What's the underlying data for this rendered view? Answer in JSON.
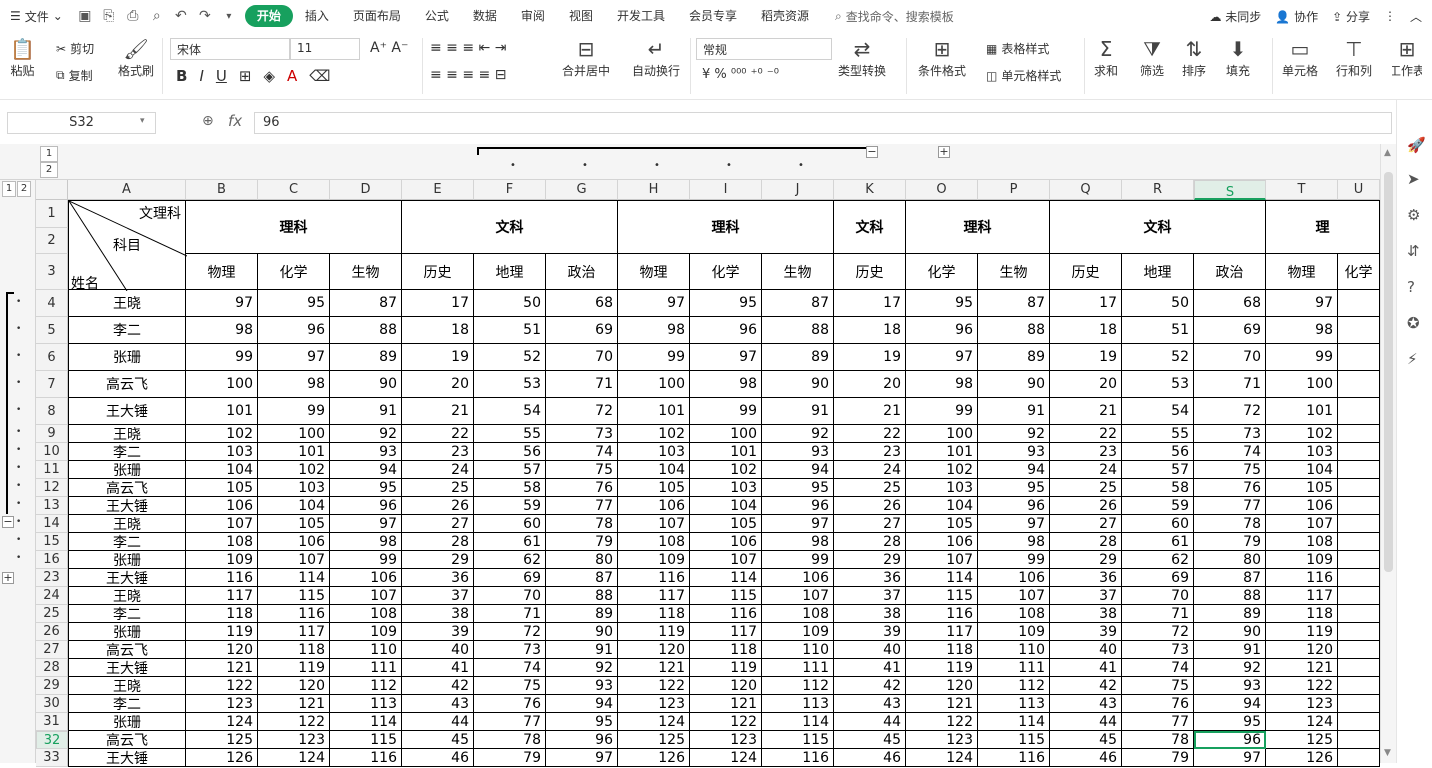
{
  "menu": {
    "file": "文件",
    "tabs": [
      "开始",
      "插入",
      "页面布局",
      "公式",
      "数据",
      "审阅",
      "视图",
      "开发工具",
      "会员专享",
      "稻壳资源"
    ],
    "search": "查找命令、搜索模板",
    "right": [
      "未同步",
      "协作",
      "分享"
    ]
  },
  "ribbon": {
    "paste": "粘贴",
    "cut": "剪切",
    "copy": "复制",
    "format_painter": "格式刷",
    "font": "宋体",
    "size": "11",
    "merge": "合并居中",
    "wrap": "自动换行",
    "numfmt": "常规",
    "convert": "类型转换",
    "cond": "条件格式",
    "table_style": "表格样式",
    "cell_style": "单元格样式",
    "sum": "求和",
    "filter": "筛选",
    "sort": "排序",
    "fill": "填充",
    "cell": "单元格",
    "rowcol": "行和列",
    "sheet": "工作表"
  },
  "formula": {
    "name": "S32",
    "value": "96"
  },
  "outline": {
    "top_levels": [
      "1",
      "2"
    ],
    "left_levels": [
      "1",
      "2"
    ],
    "minus": "−",
    "plus": "+"
  },
  "columns": [
    "A",
    "B",
    "C",
    "D",
    "E",
    "F",
    "G",
    "H",
    "I",
    "J",
    "K",
    "O",
    "P",
    "Q",
    "R",
    "S",
    "T",
    "U"
  ],
  "selected_col": "S",
  "header": {
    "diag_top": "文理科",
    "diag_mid": "科目",
    "diag_bot": "姓名",
    "groups": [
      "理科",
      "文科",
      "理科",
      "文科",
      "理科",
      "文科",
      "理"
    ],
    "subjects": [
      "物理",
      "化学",
      "生物",
      "历史",
      "地理",
      "政治",
      "物理",
      "化学",
      "生物",
      "历史",
      "化学",
      "生物",
      "历史",
      "地理",
      "政治",
      "物理",
      "化学"
    ]
  },
  "rows": [
    {
      "n": "4",
      "name": "王晓",
      "v": [
        "97",
        "95",
        "87",
        "17",
        "50",
        "68",
        "97",
        "95",
        "87",
        "17",
        "95",
        "87",
        "17",
        "50",
        "68",
        "97"
      ]
    },
    {
      "n": "5",
      "name": "李二",
      "v": [
        "98",
        "96",
        "88",
        "18",
        "51",
        "69",
        "98",
        "96",
        "88",
        "18",
        "96",
        "88",
        "18",
        "51",
        "69",
        "98"
      ]
    },
    {
      "n": "6",
      "name": "张珊",
      "v": [
        "99",
        "97",
        "89",
        "19",
        "52",
        "70",
        "99",
        "97",
        "89",
        "19",
        "97",
        "89",
        "19",
        "52",
        "70",
        "99"
      ]
    },
    {
      "n": "7",
      "name": "高云飞",
      "v": [
        "100",
        "98",
        "90",
        "20",
        "53",
        "71",
        "100",
        "98",
        "90",
        "20",
        "98",
        "90",
        "20",
        "53",
        "71",
        "100"
      ]
    },
    {
      "n": "8",
      "name": "王大锤",
      "v": [
        "101",
        "99",
        "91",
        "21",
        "54",
        "72",
        "101",
        "99",
        "91",
        "21",
        "99",
        "91",
        "21",
        "54",
        "72",
        "101"
      ]
    },
    {
      "n": "9",
      "name": "王晓",
      "v": [
        "102",
        "100",
        "92",
        "22",
        "55",
        "73",
        "102",
        "100",
        "92",
        "22",
        "100",
        "92",
        "22",
        "55",
        "73",
        "102"
      ]
    },
    {
      "n": "10",
      "name": "李二",
      "v": [
        "103",
        "101",
        "93",
        "23",
        "56",
        "74",
        "103",
        "101",
        "93",
        "23",
        "101",
        "93",
        "23",
        "56",
        "74",
        "103"
      ]
    },
    {
      "n": "11",
      "name": "张珊",
      "v": [
        "104",
        "102",
        "94",
        "24",
        "57",
        "75",
        "104",
        "102",
        "94",
        "24",
        "102",
        "94",
        "24",
        "57",
        "75",
        "104"
      ]
    },
    {
      "n": "12",
      "name": "高云飞",
      "v": [
        "105",
        "103",
        "95",
        "25",
        "58",
        "76",
        "105",
        "103",
        "95",
        "25",
        "103",
        "95",
        "25",
        "58",
        "76",
        "105"
      ]
    },
    {
      "n": "13",
      "name": "王大锤",
      "v": [
        "106",
        "104",
        "96",
        "26",
        "59",
        "77",
        "106",
        "104",
        "96",
        "26",
        "104",
        "96",
        "26",
        "59",
        "77",
        "106"
      ]
    },
    {
      "n": "14",
      "name": "王晓",
      "v": [
        "107",
        "105",
        "97",
        "27",
        "60",
        "78",
        "107",
        "105",
        "97",
        "27",
        "105",
        "97",
        "27",
        "60",
        "78",
        "107"
      ]
    },
    {
      "n": "15",
      "name": "李二",
      "v": [
        "108",
        "106",
        "98",
        "28",
        "61",
        "79",
        "108",
        "106",
        "98",
        "28",
        "106",
        "98",
        "28",
        "61",
        "79",
        "108"
      ]
    },
    {
      "n": "16",
      "name": "张珊",
      "v": [
        "109",
        "107",
        "99",
        "29",
        "62",
        "80",
        "109",
        "107",
        "99",
        "29",
        "107",
        "99",
        "29",
        "62",
        "80",
        "109"
      ]
    },
    {
      "n": "23",
      "name": "王大锤",
      "v": [
        "116",
        "114",
        "106",
        "36",
        "69",
        "87",
        "116",
        "114",
        "106",
        "36",
        "114",
        "106",
        "36",
        "69",
        "87",
        "116"
      ]
    },
    {
      "n": "24",
      "name": "王晓",
      "v": [
        "117",
        "115",
        "107",
        "37",
        "70",
        "88",
        "117",
        "115",
        "107",
        "37",
        "115",
        "107",
        "37",
        "70",
        "88",
        "117"
      ]
    },
    {
      "n": "25",
      "name": "李二",
      "v": [
        "118",
        "116",
        "108",
        "38",
        "71",
        "89",
        "118",
        "116",
        "108",
        "38",
        "116",
        "108",
        "38",
        "71",
        "89",
        "118"
      ]
    },
    {
      "n": "26",
      "name": "张珊",
      "v": [
        "119",
        "117",
        "109",
        "39",
        "72",
        "90",
        "119",
        "117",
        "109",
        "39",
        "117",
        "109",
        "39",
        "72",
        "90",
        "119"
      ]
    },
    {
      "n": "27",
      "name": "高云飞",
      "v": [
        "120",
        "118",
        "110",
        "40",
        "73",
        "91",
        "120",
        "118",
        "110",
        "40",
        "118",
        "110",
        "40",
        "73",
        "91",
        "120"
      ]
    },
    {
      "n": "28",
      "name": "王大锤",
      "v": [
        "121",
        "119",
        "111",
        "41",
        "74",
        "92",
        "121",
        "119",
        "111",
        "41",
        "119",
        "111",
        "41",
        "74",
        "92",
        "121"
      ]
    },
    {
      "n": "29",
      "name": "王晓",
      "v": [
        "122",
        "120",
        "112",
        "42",
        "75",
        "93",
        "122",
        "120",
        "112",
        "42",
        "120",
        "112",
        "42",
        "75",
        "93",
        "122"
      ]
    },
    {
      "n": "30",
      "name": "李二",
      "v": [
        "123",
        "121",
        "113",
        "43",
        "76",
        "94",
        "123",
        "121",
        "113",
        "43",
        "121",
        "113",
        "43",
        "76",
        "94",
        "123"
      ]
    },
    {
      "n": "31",
      "name": "张珊",
      "v": [
        "124",
        "122",
        "114",
        "44",
        "77",
        "95",
        "124",
        "122",
        "114",
        "44",
        "122",
        "114",
        "44",
        "77",
        "95",
        "124"
      ]
    },
    {
      "n": "32",
      "name": "高云飞",
      "v": [
        "125",
        "123",
        "115",
        "45",
        "78",
        "96",
        "125",
        "123",
        "115",
        "45",
        "123",
        "115",
        "45",
        "78",
        "96",
        "125"
      ]
    },
    {
      "n": "33",
      "name": "王大锤",
      "v": [
        "126",
        "124",
        "116",
        "46",
        "79",
        "97",
        "126",
        "124",
        "116",
        "46",
        "124",
        "116",
        "46",
        "79",
        "97",
        "126"
      ]
    }
  ]
}
